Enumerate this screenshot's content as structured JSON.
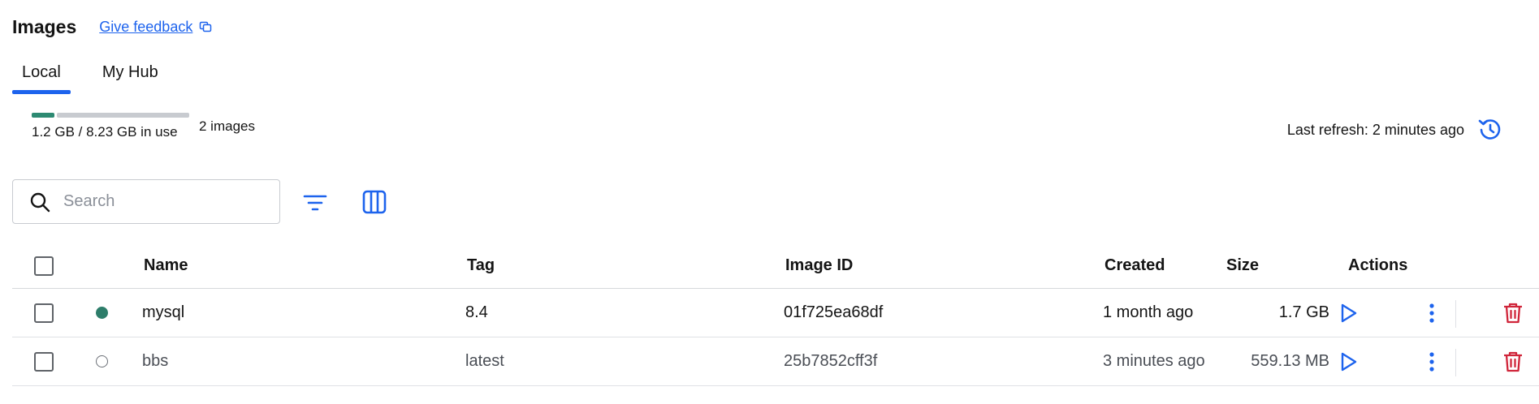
{
  "header": {
    "title": "Images",
    "feedback_label": "Give feedback"
  },
  "tabs": [
    {
      "label": "Local",
      "active": true
    },
    {
      "label": "My Hub",
      "active": false
    }
  ],
  "usage": {
    "text": "1.2 GB / 8.23 GB in use",
    "used_fraction": 0.146,
    "images_count": "2 images"
  },
  "refresh": {
    "text": "Last refresh: 2 minutes ago"
  },
  "search": {
    "placeholder": "Search",
    "value": ""
  },
  "table": {
    "columns": [
      "Name",
      "Tag",
      "Image ID",
      "Created",
      "Size",
      "Actions"
    ],
    "rows": [
      {
        "status": "in-use",
        "name": "mysql",
        "tag": "8.4",
        "image_id": "01f725ea68df",
        "created": "1 month ago",
        "size": "1.7 GB"
      },
      {
        "status": "unused",
        "name": "bbs",
        "tag": "latest",
        "image_id": "25b7852cff3f",
        "created": "3 minutes ago",
        "size": "559.13 MB"
      }
    ]
  },
  "icons": {
    "feedback": "external-feedback-icon",
    "refresh": "refresh-icon",
    "search": "search-icon",
    "filter": "filter-icon",
    "columns": "columns-icon",
    "run": "play-icon",
    "more": "more-vertical-icon",
    "delete": "trash-icon"
  },
  "colors": {
    "accent": "#1d63ed",
    "in_use": "#2d7d6a",
    "delete": "#d0253a"
  }
}
